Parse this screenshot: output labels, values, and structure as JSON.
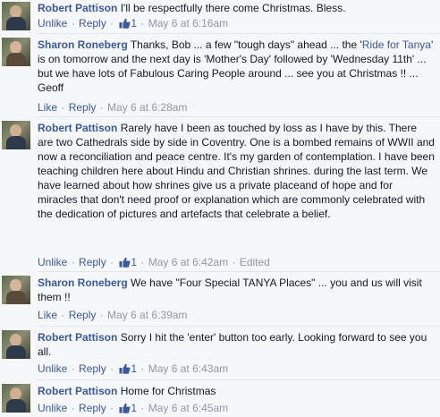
{
  "comments": [
    {
      "author": "Robert Pattison",
      "text": "I'll be respectfully there come Christmas. Bless.",
      "actions": [
        "Unlike",
        "Reply"
      ],
      "likes": "1",
      "time": "May 6 at 6:16am"
    },
    {
      "author": "Sharon Roneberg",
      "text_before": "Thanks, Bob ... a few \"tough days\" ahead ... the '",
      "link": "Ride for Tanya",
      "text_after": "' is on tomorrow and the next day is 'Mother's Day' followed by 'Wednesday 11th' ... but we have lots of Fabulous Caring People around ... see you at Christmas !! ... Geoff",
      "actions": [
        "Like",
        "Reply"
      ],
      "time": "May 6 at 6:28am"
    },
    {
      "author": "Robert Pattison",
      "text": "Rarely have I been as touched by loss as I have by this. There are two Cathedrals side by side in Coventry. One is a bombed remains of WWII and now a reconciliation and peace centre. It's my garden of contemplation. I have been teaching children here about Hindu and Christian shrines. during the last term. We have learned about how shrines give us a private placeand of hope and for miracles that don't need proof or explanation which are commonly celebrated with the dedication of pictures and artefacts that celebrate a belief.",
      "actions": [
        "Unlike",
        "Reply"
      ],
      "likes": "1",
      "time": "May 6 at 6:42am",
      "edited": "Edited"
    },
    {
      "author": "Sharon Roneberg",
      "text": "We have \"Four Special TANYA Places\" ... you and us will visit them !!",
      "actions": [
        "Like",
        "Reply"
      ],
      "time": "May 6 at 6:39am"
    },
    {
      "author": "Robert Pattison",
      "text": "Sorry I hit the 'enter' button too early. Looking forward to see you all.",
      "actions": [
        "Unlike",
        "Reply"
      ],
      "likes": "1",
      "time": "May 6 at 6:43am"
    },
    {
      "author": "Robert Pattison",
      "text": "Home for Christmas",
      "actions": [
        "Unlike",
        "Reply"
      ],
      "likes": "1",
      "time": "May 6 at 6:45am"
    }
  ],
  "colors": {
    "link": "#3b5998",
    "meta": "#9197a3",
    "text": "#141823",
    "background": "#f6f7f9"
  },
  "icons": {
    "like": "thumbs-up-icon",
    "avatar": "profile-photo"
  }
}
